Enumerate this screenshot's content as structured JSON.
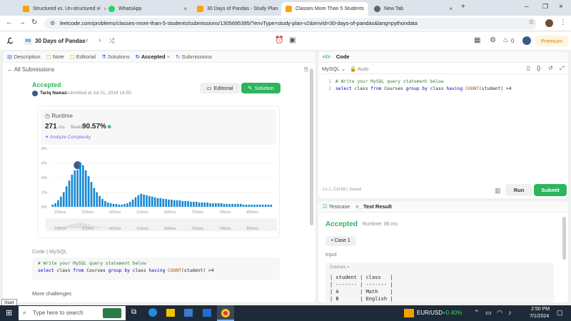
{
  "browser": {
    "tabs": [
      {
        "title": "Structured vs. Un-structured vi",
        "color": "#f4a300"
      },
      {
        "title": "WhatsApp",
        "color": "#25d366"
      },
      {
        "title": "30 Days of Pandas - Study Plan",
        "color": "#ffa116"
      },
      {
        "title": "Classes More Than 5 Students",
        "color": "#ffa116"
      },
      {
        "title": "New Tab",
        "color": "#5f6368"
      }
    ],
    "url": "leetcode.com/problems/classes-more-than-5-students/submissions/1305695395/?envType=study-plan-v2&envId=30-days-of-pandas&lang=pythondata"
  },
  "header": {
    "plan_badge": "PD",
    "plan_title": "30 Days of Pandas",
    "notif_count": "0",
    "premium_label": "Premium"
  },
  "left": {
    "tabs": [
      "Description",
      "Note",
      "Editorial",
      "Solutions",
      "Accepted",
      "Submissions"
    ],
    "back_label": "All Submissions",
    "status": "Accepted",
    "user": "Tariq Nawaz",
    "submitted": "submitted at Jul 01, 2024 14:50",
    "editorial_btn": "Editorial",
    "solution_btn": "Solution",
    "runtime_label": "Runtime",
    "runtime_value": "271",
    "runtime_unit": "ms",
    "beats_label": "Beats",
    "beats_value": "90.57%",
    "analyze_label": "Analyze Complexity",
    "code_lang": "Code | MySQL",
    "code_comment": "# Write your MySQL query statement below",
    "more_label": "More challenges"
  },
  "chart_data": {
    "type": "bar",
    "title": "",
    "xlabel": "",
    "ylabel": "",
    "ylim": [
      0,
      8
    ],
    "yticks": [
      "8%",
      "6%",
      "4%",
      "2%",
      "0%"
    ],
    "xticks": [
      "235ms",
      "329ms",
      "422ms",
      "516ms",
      "609ms",
      "703ms",
      "796ms",
      "890ms"
    ],
    "values": [
      0.3,
      0.5,
      0.9,
      1.4,
      2.0,
      2.8,
      3.6,
      4.4,
      5.0,
      5.6,
      6.1,
      5.7,
      5.0,
      4.2,
      3.4,
      2.6,
      2.0,
      1.5,
      1.1,
      0.8,
      0.6,
      0.5,
      0.4,
      0.4,
      0.3,
      0.3,
      0.4,
      0.5,
      0.7,
      1.0,
      1.3,
      1.6,
      1.8,
      1.7,
      1.6,
      1.5,
      1.4,
      1.3,
      1.2,
      1.2,
      1.1,
      1.1,
      1.0,
      1.0,
      0.9,
      0.9,
      0.9,
      0.8,
      0.8,
      0.8,
      0.7,
      0.7,
      0.7,
      0.6,
      0.6,
      0.6,
      0.6,
      0.5,
      0.5,
      0.5,
      0.5,
      0.5,
      0.4,
      0.4,
      0.4,
      0.4,
      0.4,
      0.4,
      0.4,
      0.3,
      0.3,
      0.3,
      0.3,
      0.3,
      0.3,
      0.3,
      0.3,
      0.3,
      0.3,
      0.3
    ],
    "highlight_index": 9,
    "bar_color": "#1a8ad4"
  },
  "editor": {
    "title": "Code",
    "lang": "MySQL",
    "auto": "Auto",
    "line_numbers": [
      "1",
      "2"
    ],
    "comment": "# Write your MySQL query statement below",
    "status": "Ln 2, Col 68  |  Saved",
    "run_btn": "Run",
    "submit_btn": "Submit"
  },
  "result": {
    "tabs": [
      "Testcase",
      "Test Result"
    ],
    "status": "Accepted",
    "runtime": "Runtime: 86 ms",
    "case_label": "Case 1",
    "input_label": "Input",
    "table_label": "Courses =",
    "table_lines": [
      "| student | class   |",
      "| ------- | ------- |",
      "| A       | Math    |",
      "| B       | English |"
    ]
  },
  "taskbar": {
    "search_placeholder": "Type here to search",
    "ticker": "EUR/USD",
    "ticker_change": "+0.40%",
    "time": "2:50 PM",
    "date": "7/1/2024",
    "start_tip": "Start"
  }
}
